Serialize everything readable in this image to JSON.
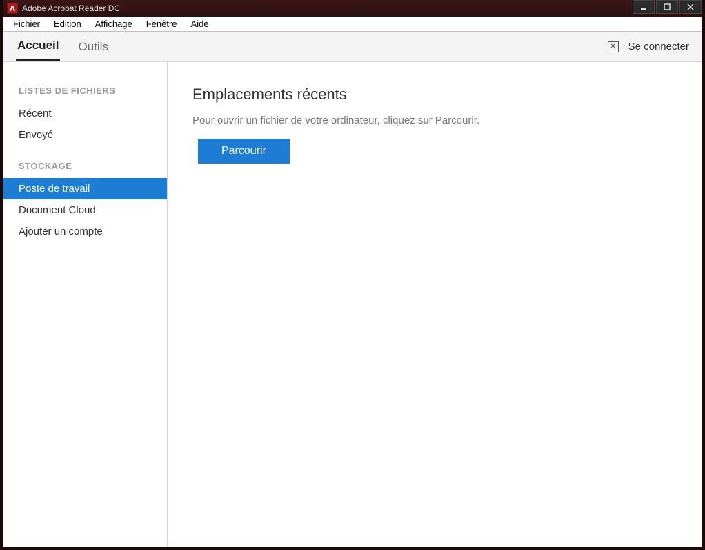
{
  "titlebar": {
    "app_title": "Adobe Acrobat Reader DC"
  },
  "menubar": {
    "items": [
      "Fichier",
      "Edition",
      "Affichage",
      "Fenêtre",
      "Aide"
    ]
  },
  "toolbar": {
    "tab_home": "Accueil",
    "tab_tools": "Outils",
    "sign_in": "Se connecter"
  },
  "sidebar": {
    "section_lists": "LISTES DE FICHIERS",
    "item_recent": "Récent",
    "item_sent": "Envoyé",
    "section_storage": "STOCKAGE",
    "item_workstation": "Poste de travail",
    "item_doc_cloud": "Document Cloud",
    "item_add_account": "Ajouter un compte"
  },
  "content": {
    "heading": "Emplacements récents",
    "hint": "Pour ouvrir un fichier de votre ordinateur, cliquez sur Parcourir.",
    "browse_label": "Parcourir"
  }
}
